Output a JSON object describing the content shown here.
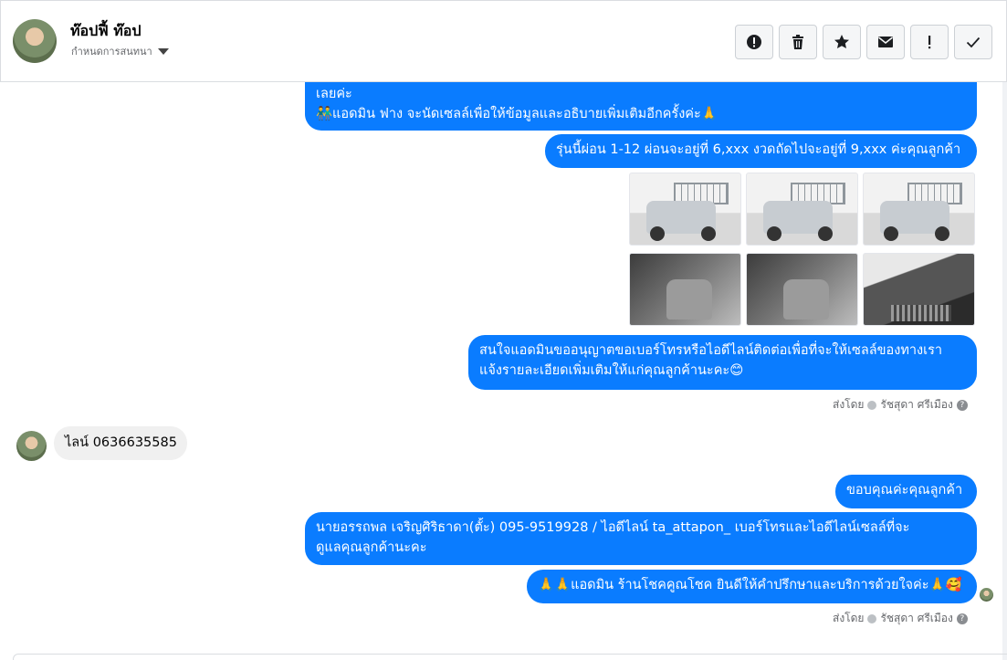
{
  "header": {
    "name": "ท๊อปฟี้ ท๊อป",
    "subtitle": "กำหนดการสนทนา"
  },
  "messages": {
    "m1_line1": "เลยค่ะ",
    "m1_line2": "👬แอดมิน ฟาง จะนัดเซลล์เพื่อให้ข้อมูลและอธิบายเพิ่มเติมอีกครั้งค่ะ🙏",
    "m2": "รุ่นนี้ผ่อน 1-12 ผ่อนจะอยู่ที่ 6,xxx งวดถัดไปจะอยู่ที่ 9,xxx  ค่ะคุณลูกค้า",
    "m3_line1": "สนใจแอดมินขออนุญาตขอเบอร์โทรหรือไอดีไลน์ติดต่อเพื่อที่จะให้เซลล์ของทางเรา",
    "m3_line2": "แจ้งรายละเอียดเพิ่มเติมให้แก่คุณลูกค้านะคะ😊",
    "in1": "ไลน์ 0636635585",
    "m4": "ขอบคุณค่ะคุณลูกค้า",
    "m5_line1": "นายอรรถพล เจริญศิริธาดา(ตั้ะ)      095-9519928 / ไอดีไลน์ ta_attapon_   เบอร์โทรและไอดีไลน์เซลล์ที่จะ",
    "m5_line2": "ดูแลคุณลูกค้านะคะ",
    "m6": "🙏🙏แอดมิน ร้านโชคคูณโชค ยินดีให้คำปรึกษาและบริการด้วยใจค่ะ🙏🥰"
  },
  "meta": {
    "sent_by_label": "ส่งโดย",
    "sender_name": "รัชสุดา ศรีเมือง"
  },
  "icons": {
    "alert": "alert-circle-icon",
    "trash": "trash-icon",
    "star": "star-icon",
    "mail": "mail-icon",
    "exclaim": "exclamation-icon",
    "check": "check-icon"
  },
  "colors": {
    "outgoing_bubble": "#0a7cff",
    "incoming_bubble": "#f0f0f0"
  }
}
